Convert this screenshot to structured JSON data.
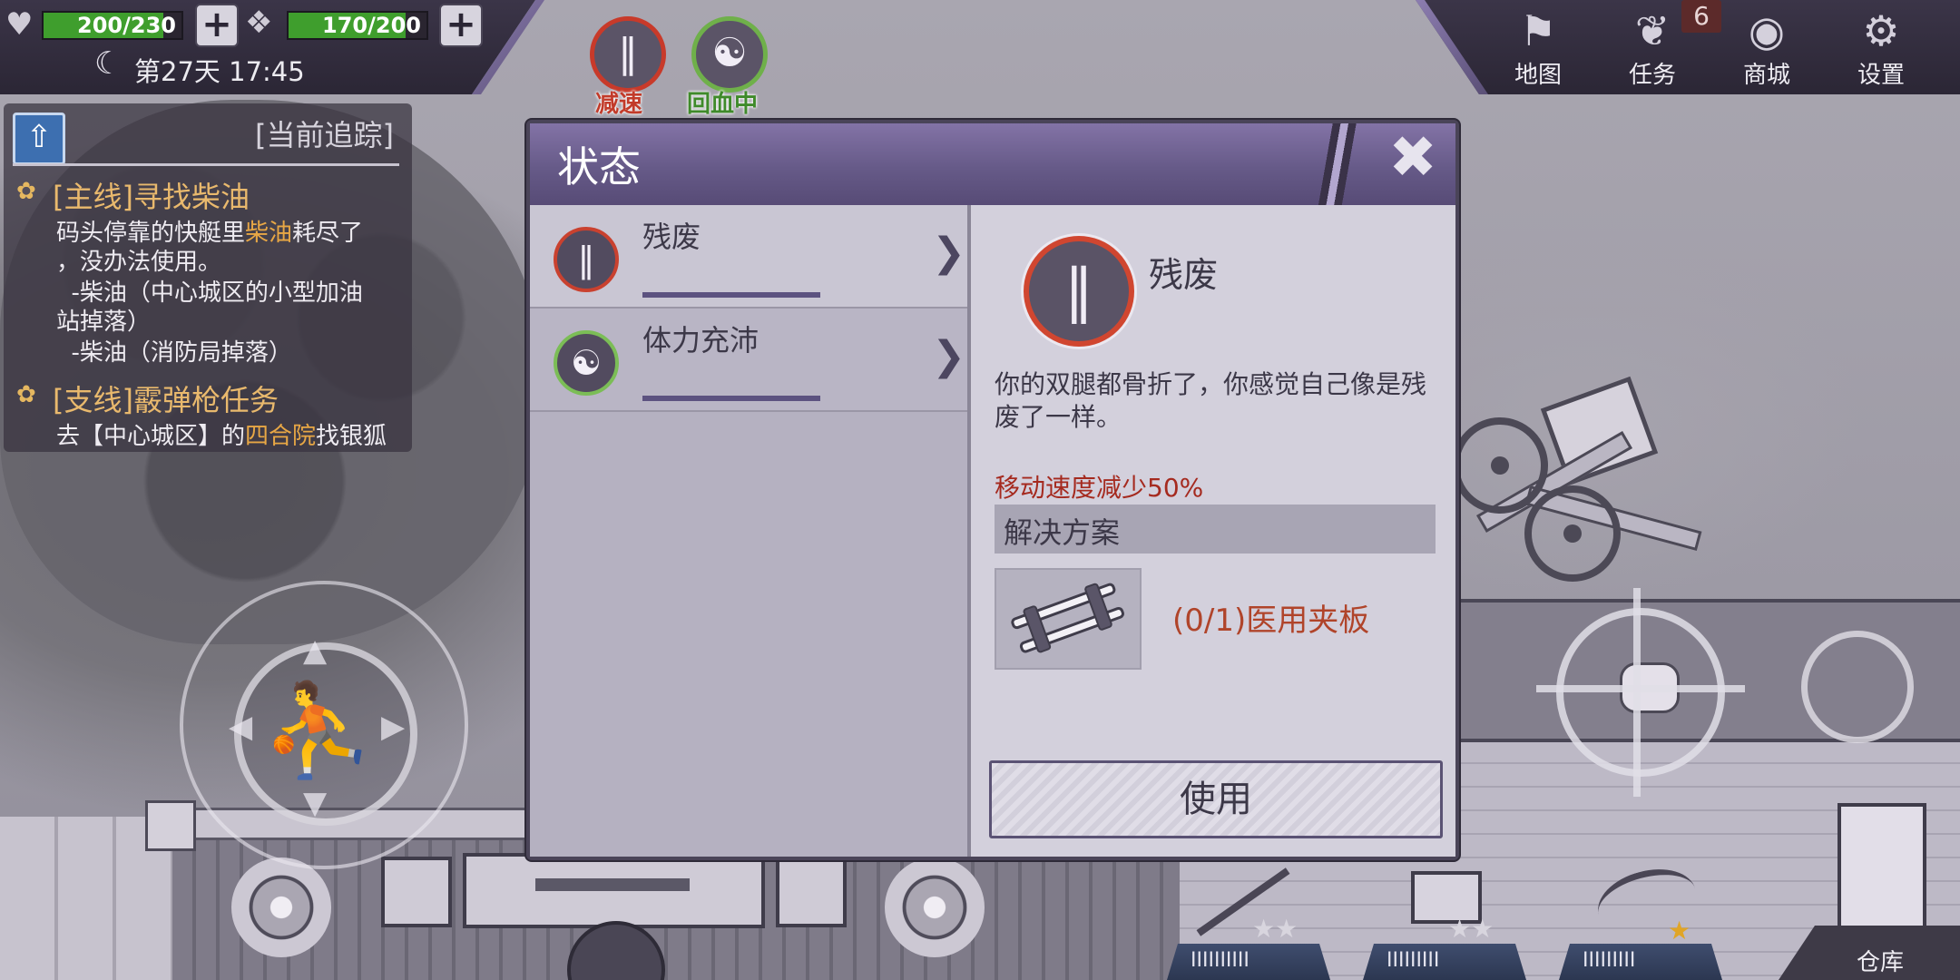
{
  "hud": {
    "health": {
      "text": "200/230",
      "current": 200,
      "max": 230
    },
    "stamina": {
      "text": "170/200",
      "current": 170,
      "max": 200
    },
    "day_time": "第27天 17:45",
    "status_effects": [
      {
        "label": "减速",
        "color": "#c23b2a",
        "icon": "crutches-icon"
      },
      {
        "label": "回血中",
        "color": "#3f8a2a",
        "icon": "strongman-icon"
      }
    ],
    "menu": [
      {
        "label": "地图",
        "icon": "map-icon"
      },
      {
        "label": "任务",
        "icon": "scroll-icon",
        "badge": "6"
      },
      {
        "label": "商城",
        "icon": "coins-icon"
      },
      {
        "label": "设置",
        "icon": "gear-icon"
      }
    ]
  },
  "tracker": {
    "header": "[当前追踪]",
    "quests": [
      {
        "title": "[主线]寻找柴油",
        "lines": {
          "l1a": "码头停靠的快艇里",
          "l1b": "柴油",
          "l1c": "耗尽了",
          "l2": "，没办法使用。",
          "l3": "  -柴油（中心城区的小型加油",
          "l4": "站掉落）",
          "l5": "  -柴油（消防局掉落）"
        }
      },
      {
        "title": "[支线]霰弹枪任务",
        "lines": {
          "l1a": "去【中心城区】的",
          "l1b": "四合院",
          "l1c": "找银狐"
        }
      }
    ]
  },
  "modal": {
    "title": "状态",
    "close": "✖",
    "list": [
      {
        "name": "残废",
        "icon": "crutches-icon",
        "ring": "#c9412f"
      },
      {
        "name": "体力充沛",
        "icon": "strongman-icon",
        "ring": "#7bbd56"
      }
    ],
    "detail": {
      "name": "残废",
      "description": "你的双腿都骨折了，你感觉自己像是残废了一样。",
      "effect": "移动速度减少50%",
      "solution_label": "解决方案",
      "item": "(0/1)医用夹板",
      "use_button": "使用"
    }
  },
  "hotbar": {
    "slot_labels": [
      "IIIIIIIIII",
      "IIIIIIIII",
      "IIIIIIIII"
    ],
    "warehouse": "仓库"
  },
  "colors": {
    "accent": "#665a88",
    "health_fill": "#3f9e2d",
    "effect_text": "#a52a1f",
    "item_text": "#b0442a",
    "quest_highlight": "#e8a745"
  }
}
